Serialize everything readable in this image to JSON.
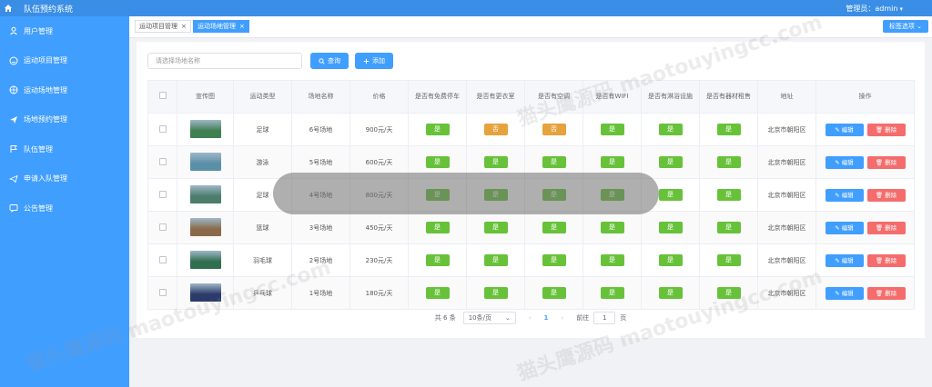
{
  "app": {
    "title": "队伍预约系统",
    "admin_label": "管理员：admin"
  },
  "sidebar": {
    "items": [
      {
        "label": "用户管理",
        "icon": "user-icon"
      },
      {
        "label": "运动项目管理",
        "icon": "smile-icon"
      },
      {
        "label": "运动场地管理",
        "icon": "basketball-icon"
      },
      {
        "label": "场地预约管理",
        "icon": "send-icon"
      },
      {
        "label": "队伍管理",
        "icon": "flag-icon"
      },
      {
        "label": "申请入队管理",
        "icon": "paper-plane-icon"
      },
      {
        "label": "公告管理",
        "icon": "chat-icon"
      }
    ]
  },
  "tabs": [
    {
      "label": "运动项目管理",
      "active": false
    },
    {
      "label": "运动场地管理",
      "active": true
    }
  ],
  "tab_options_label": "标签选项",
  "search": {
    "placeholder": "请选择场地名称"
  },
  "buttons": {
    "query": "查询",
    "add": "添加"
  },
  "table": {
    "headers": [
      "宣传图",
      "运动类型",
      "场地名称",
      "价格",
      "是否有免费停车",
      "是否有更衣室",
      "是否有空调",
      "是否有WIFI",
      "是否有淋浴设施",
      "是否有器材租售",
      "地址",
      "操作"
    ],
    "yes_label": "是",
    "no_label": "否",
    "edit_label": "编辑",
    "delete_label": "删除",
    "rows": [
      {
        "thumb_color": "#3f7f52",
        "sport": "足球",
        "venue": "6号场地",
        "price": "900元/天",
        "flags": [
          true,
          false,
          false,
          true,
          true,
          true
        ],
        "address": "北京市朝阳区"
      },
      {
        "thumb_color": "#5a8fa8",
        "sport": "游泳",
        "venue": "5号场地",
        "price": "600元/天",
        "flags": [
          true,
          true,
          true,
          true,
          true,
          true
        ],
        "address": "北京市朝阳区"
      },
      {
        "thumb_color": "#4b7d6a",
        "sport": "足球",
        "venue": "4号场地",
        "price": "800元/天",
        "flags": [
          true,
          true,
          true,
          true,
          true,
          true
        ],
        "address": "北京市朝阳区"
      },
      {
        "thumb_color": "#8a6a4a",
        "sport": "篮球",
        "venue": "3号场地",
        "price": "450元/天",
        "flags": [
          true,
          true,
          true,
          true,
          true,
          true
        ],
        "address": "北京市朝阳区"
      },
      {
        "thumb_color": "#2f6e4e",
        "sport": "羽毛球",
        "venue": "2号场地",
        "price": "230元/天",
        "flags": [
          true,
          true,
          true,
          true,
          true,
          true
        ],
        "address": "北京市朝阳区"
      },
      {
        "thumb_color": "#2a3a6a",
        "sport": "乒乓球",
        "venue": "1号场地",
        "price": "180元/天",
        "flags": [
          true,
          true,
          true,
          true,
          true,
          true
        ],
        "address": "北京市朝阳区"
      }
    ]
  },
  "pagination": {
    "total_label": "共 6 条",
    "page_size": "10条/页",
    "current_page": "1",
    "goto_label": "前往",
    "goto_value": "1",
    "page_unit": "页"
  },
  "overlay_text": "猫头鹰源码 maotouyingcc.com",
  "watermark_text": "猫头鹰源码 maotouyingcc.com",
  "colors": {
    "primary": "#409eff",
    "success": "#67c23a",
    "warning": "#e6a23c",
    "danger": "#f56c6c"
  }
}
